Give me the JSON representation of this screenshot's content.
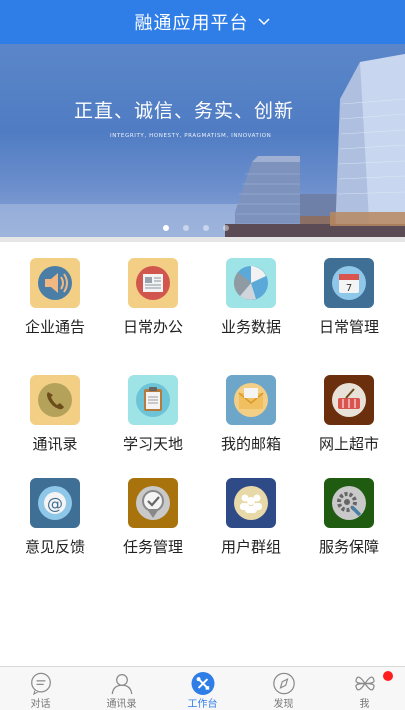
{
  "header": {
    "title": "融通应用平台"
  },
  "banner": {
    "slogan": "正直、诚信、务实、创新",
    "slogan_en": "INTEGRITY, HONESTY, PRAGMATISM, INNOVATION",
    "dots": 4,
    "active_dot": 0
  },
  "grid": {
    "items": [
      {
        "label": "企业通告",
        "icon": "speaker-icon",
        "color": "#f2cf85"
      },
      {
        "label": "日常办公",
        "icon": "newspaper-icon",
        "color": "#f2cf85"
      },
      {
        "label": "业务数据",
        "icon": "pie-chart-icon",
        "color": "#9ee3e6"
      },
      {
        "label": "日常管理",
        "icon": "calendar-icon",
        "color": "#3f6f94"
      },
      {
        "label": "通讯录",
        "icon": "phone-icon",
        "color": "#f2cf85"
      },
      {
        "label": "学习天地",
        "icon": "clipboard-icon",
        "color": "#9ee3e6"
      },
      {
        "label": "我的邮箱",
        "icon": "envelope-icon",
        "color": "#6ea6c9"
      },
      {
        "label": "网上超市",
        "icon": "basket-icon",
        "color": "#6b2f0e"
      },
      {
        "label": "意见反馈",
        "icon": "at-sign-icon",
        "color": "#3f6f94"
      },
      {
        "label": "任务管理",
        "icon": "check-badge-icon",
        "color": "#a8720c"
      },
      {
        "label": "用户群组",
        "icon": "group-icon",
        "color": "#2e4a87"
      },
      {
        "label": "服务保障",
        "icon": "gear-wrench-icon",
        "color": "#1f5c12"
      }
    ]
  },
  "tabbar": {
    "items": [
      {
        "label": "对话",
        "icon": "chat-icon"
      },
      {
        "label": "通讯录",
        "icon": "contacts-icon"
      },
      {
        "label": "工作台",
        "icon": "workbench-icon",
        "active": true
      },
      {
        "label": "发现",
        "icon": "compass-icon"
      },
      {
        "label": "我",
        "icon": "clover-icon",
        "badge": true
      }
    ]
  },
  "colors": {
    "primary": "#2f7ee8",
    "badge": "#ff1e1e"
  }
}
